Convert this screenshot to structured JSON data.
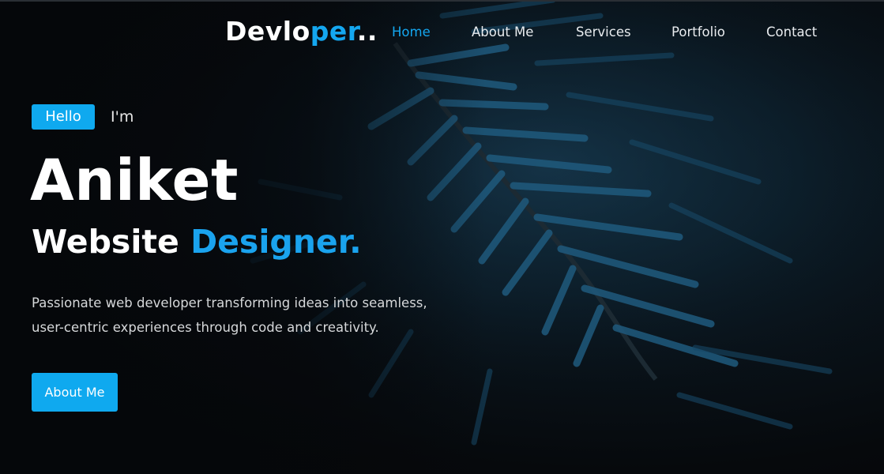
{
  "header": {
    "logo_main": "Devlo",
    "logo_accent": "per",
    "logo_tail": "..",
    "nav": [
      {
        "label": "Home",
        "active": true
      },
      {
        "label": "About Me",
        "active": false
      },
      {
        "label": "Services",
        "active": false
      },
      {
        "label": "Portfolio",
        "active": false
      },
      {
        "label": "Contact",
        "active": false
      }
    ]
  },
  "hero": {
    "hello_badge": "Hello",
    "intro": "I'm",
    "name": "Aniket",
    "role_prefix": "Website",
    "role_accent": "Designer.",
    "description_line1": "Passionate web developer transforming ideas into seamless,",
    "description_line2": "user-centric experiences through code and creativity.",
    "cta_label": "About Me"
  },
  "colors": {
    "accent": "#14a7f0",
    "background": "#07090c",
    "text": "#ffffff"
  }
}
